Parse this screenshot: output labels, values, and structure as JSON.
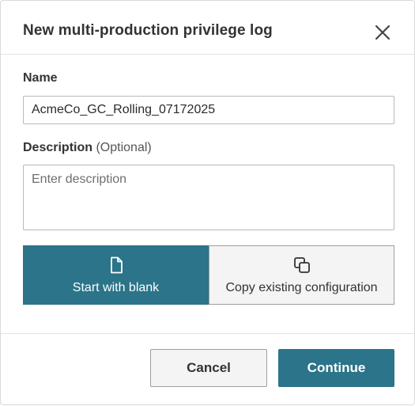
{
  "dialog": {
    "title": "New multi-production privilege log",
    "close_icon": "close-icon"
  },
  "form": {
    "name_label": "Name",
    "name_value": "AcmeCo_GC_Rolling_07172025",
    "description_label": "Description",
    "description_optional": "(Optional)",
    "description_placeholder": "Enter description",
    "description_value": ""
  },
  "options": [
    {
      "label": "Start with blank",
      "icon": "blank-document-icon",
      "selected": true
    },
    {
      "label": "Copy existing configuration",
      "icon": "copy-icon",
      "selected": false
    }
  ],
  "footer": {
    "cancel_label": "Cancel",
    "continue_label": "Continue"
  },
  "colors": {
    "accent": "#2b7489",
    "secondary_bg": "#f4f4f4",
    "border": "#b9b9b9"
  }
}
